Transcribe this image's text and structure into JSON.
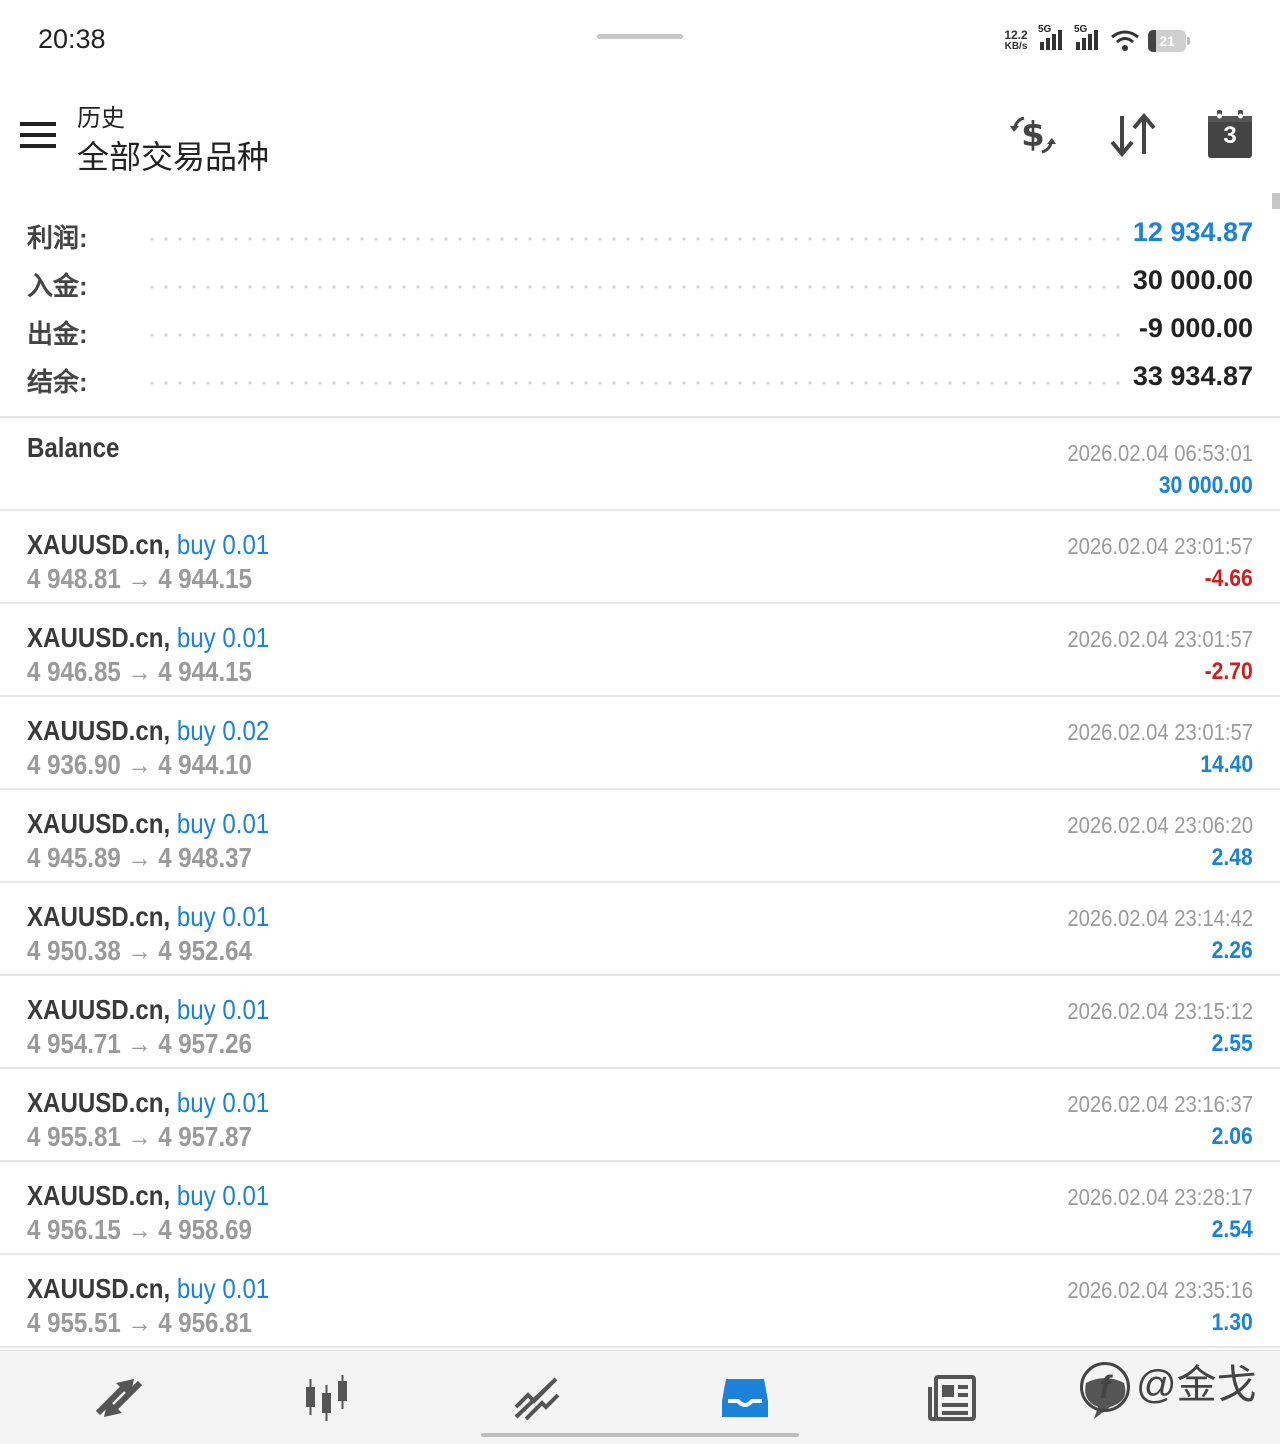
{
  "status_bar": {
    "time": "20:38",
    "net_speed_value": "12.2",
    "net_speed_unit": "KB/s",
    "sim1_label": "5G",
    "sim2_label": "5G",
    "battery": "21"
  },
  "header": {
    "subtitle": "历史",
    "title": "全部交易品种",
    "calendar_badge": "3"
  },
  "summary": {
    "profit_label": "利润:",
    "profit_value": "12 934.87",
    "deposit_label": "入金:",
    "deposit_value": "30 000.00",
    "withdrawal_label": "出金:",
    "withdrawal_value": "-9 000.00",
    "balance_label": "结余:",
    "balance_value": "33 934.87"
  },
  "balance_entry": {
    "label": "Balance",
    "time": "2026.02.04 06:53:01",
    "amount": "30 000.00"
  },
  "deals": [
    {
      "symbol": "XAUUSD.cn,",
      "side": "buy 0.01",
      "prices": "4 948.81 → 4 944.15",
      "time": "2026.02.04 23:01:57",
      "profit": "-4.66",
      "sign": "neg"
    },
    {
      "symbol": "XAUUSD.cn,",
      "side": "buy 0.01",
      "prices": "4 946.85 → 4 944.15",
      "time": "2026.02.04 23:01:57",
      "profit": "-2.70",
      "sign": "neg"
    },
    {
      "symbol": "XAUUSD.cn,",
      "side": "buy 0.02",
      "prices": "4 936.90 → 4 944.10",
      "time": "2026.02.04 23:01:57",
      "profit": "14.40",
      "sign": "pos"
    },
    {
      "symbol": "XAUUSD.cn,",
      "side": "buy 0.01",
      "prices": "4 945.89 → 4 948.37",
      "time": "2026.02.04 23:06:20",
      "profit": "2.48",
      "sign": "pos"
    },
    {
      "symbol": "XAUUSD.cn,",
      "side": "buy 0.01",
      "prices": "4 950.38 → 4 952.64",
      "time": "2026.02.04 23:14:42",
      "profit": "2.26",
      "sign": "pos"
    },
    {
      "symbol": "XAUUSD.cn,",
      "side": "buy 0.01",
      "prices": "4 954.71 → 4 957.26",
      "time": "2026.02.04 23:15:12",
      "profit": "2.55",
      "sign": "pos"
    },
    {
      "symbol": "XAUUSD.cn,",
      "side": "buy 0.01",
      "prices": "4 955.81 → 4 957.87",
      "time": "2026.02.04 23:16:37",
      "profit": "2.06",
      "sign": "pos"
    },
    {
      "symbol": "XAUUSD.cn,",
      "side": "buy 0.01",
      "prices": "4 956.15 → 4 958.69",
      "time": "2026.02.04 23:28:17",
      "profit": "2.54",
      "sign": "pos"
    },
    {
      "symbol": "XAUUSD.cn,",
      "side": "buy 0.01",
      "prices": "4 955.51 → 4 956.81",
      "time": "2026.02.04 23:35:16",
      "profit": "1.30",
      "sign": "pos"
    }
  ],
  "bottom_nav": {
    "items": [
      "quotes-icon",
      "chart-icon",
      "trade-icon",
      "history-icon",
      "news-icon",
      "messages-icon"
    ],
    "active": "history-icon",
    "active_color": "#1a82d9"
  },
  "watermark": {
    "text": "@金戈"
  },
  "colors": {
    "positive": "#1a82d9",
    "negative": "#d01e1e",
    "muted": "#9a9a9a"
  }
}
